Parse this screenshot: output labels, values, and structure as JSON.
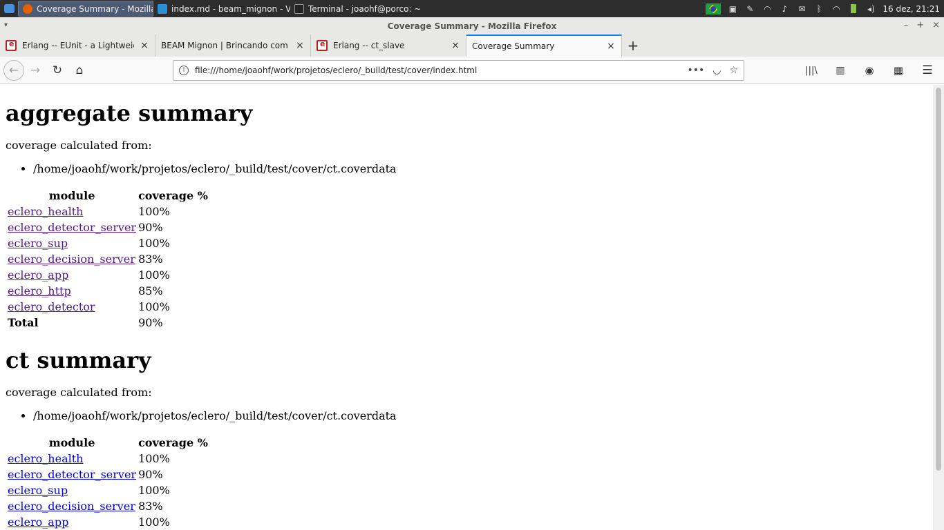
{
  "taskbar": {
    "tasks": [
      {
        "label": "Coverage Summary - Mozilla...",
        "icon": "firefox-icon"
      },
      {
        "label": "index.md - beam_mignon - Vi...",
        "icon": "vscode-icon"
      },
      {
        "label": "Terminal - joaohf@porco: ~",
        "icon": "terminal-icon"
      }
    ],
    "clock": "16 dez, 21:21"
  },
  "window": {
    "title": "Coverage Summary - Mozilla Firefox"
  },
  "tabs": [
    {
      "label": "Erlang -- EUnit - a Lightweight"
    },
    {
      "label": "BEAM Mignon | Brincando com E"
    },
    {
      "label": "Erlang -- ct_slave"
    },
    {
      "label": "Coverage Summary"
    }
  ],
  "navbar": {
    "url": "file:///home/joaohf/work/projetos/eclero/_build/test/cover/index.html"
  },
  "page": {
    "sections": [
      {
        "title": "aggregate summary",
        "calc_label": "coverage calculated from:",
        "files": [
          "/home/joaohf/work/projetos/eclero/_build/test/cover/ct.coverdata"
        ],
        "headers": {
          "module": "module",
          "coverage": "coverage %"
        },
        "rows": [
          {
            "module": "eclero_health",
            "coverage": "100%"
          },
          {
            "module": "eclero_detector_server",
            "coverage": "90%"
          },
          {
            "module": "eclero_sup",
            "coverage": "100%"
          },
          {
            "module": "eclero_decision_server",
            "coverage": "83%"
          },
          {
            "module": "eclero_app",
            "coverage": "100%"
          },
          {
            "module": "eclero_http",
            "coverage": "85%"
          },
          {
            "module": "eclero_detector",
            "coverage": "100%"
          }
        ],
        "total": {
          "label": "Total",
          "coverage": "90%"
        }
      },
      {
        "title": "ct summary",
        "calc_label": "coverage calculated from:",
        "files": [
          "/home/joaohf/work/projetos/eclero/_build/test/cover/ct.coverdata"
        ],
        "headers": {
          "module": "module",
          "coverage": "coverage %"
        },
        "rows": [
          {
            "module": "eclero_health",
            "coverage": "100%"
          },
          {
            "module": "eclero_detector_server",
            "coverage": "90%"
          },
          {
            "module": "eclero_sup",
            "coverage": "100%"
          },
          {
            "module": "eclero_decision_server",
            "coverage": "83%"
          },
          {
            "module": "eclero_app",
            "coverage": "100%"
          }
        ]
      }
    ]
  }
}
